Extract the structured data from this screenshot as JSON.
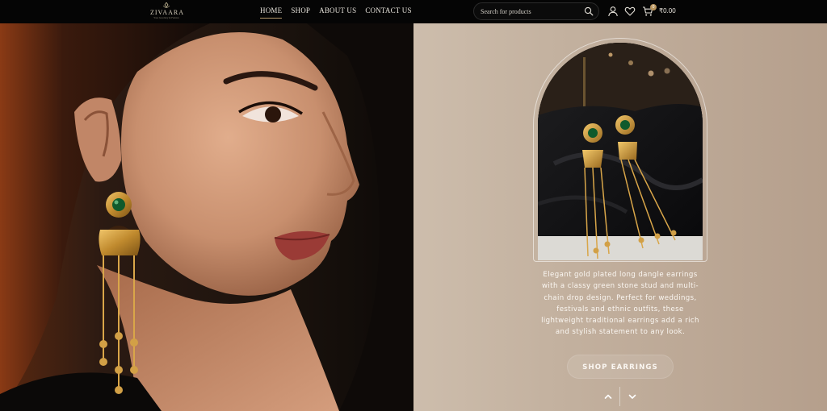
{
  "header": {
    "logo_text": "ZIVAARA",
    "logo_tagline": "Your Jewellery & Fashion",
    "nav": [
      {
        "label": "HOME",
        "active": true
      },
      {
        "label": "SHOP",
        "active": false
      },
      {
        "label": "ABOUT US",
        "active": false
      },
      {
        "label": "CONTACT US",
        "active": false
      }
    ],
    "search_placeholder": "Search for products",
    "cart_count": "0",
    "cart_total": "₹0.00",
    "icons": [
      "search-icon",
      "user-icon",
      "heart-icon",
      "cart-icon"
    ]
  },
  "hero": {
    "description": "Elegant gold plated long dangle earrings with a classy green stone stud and multi-chain drop design. Perfect for weddings, festivals and ethnic outfits, these lightweight traditional earrings add a rich and stylish statement to any look.",
    "cta_label": "SHOP EARRINGS",
    "slider_icons": [
      "chevron-up-icon",
      "chevron-down-icon"
    ]
  },
  "colors": {
    "header_bg": "#050505",
    "accent_gold": "#b89b6c",
    "panel_bg": "#c6b4a2",
    "text_light": "#fbf7f2"
  }
}
